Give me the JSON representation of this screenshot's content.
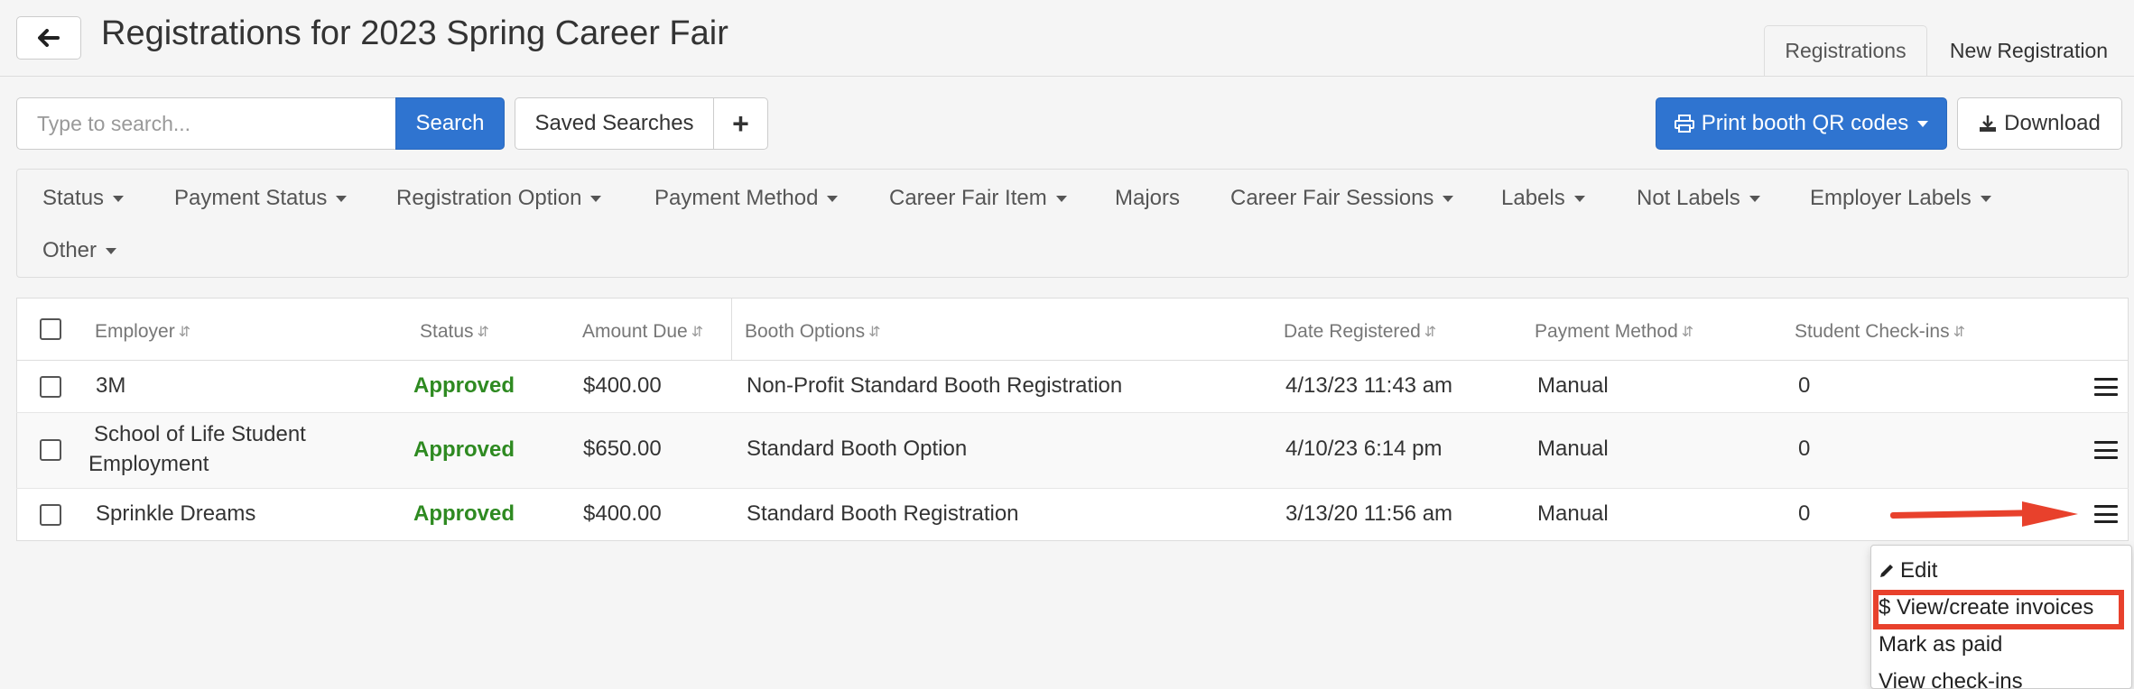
{
  "header": {
    "back_icon": "arrow-left-icon",
    "title": "Registrations for 2023 Spring Career Fair",
    "tabs": [
      {
        "label": "Registrations",
        "active": true
      },
      {
        "label": "New Registration",
        "active": false
      }
    ]
  },
  "toolbar": {
    "search_placeholder": "Type to search...",
    "search_label": "Search",
    "saved_searches_label": "Saved Searches",
    "add_icon": "plus-icon",
    "print_label": "Print booth QR codes",
    "print_icon": "printer-icon",
    "download_label": "Download",
    "download_icon": "download-icon"
  },
  "filters": [
    {
      "label": "Status",
      "dropdown": true
    },
    {
      "label": "Payment Status",
      "dropdown": true
    },
    {
      "label": "Registration Option",
      "dropdown": true
    },
    {
      "label": "Payment Method",
      "dropdown": true
    },
    {
      "label": "Career Fair Item",
      "dropdown": true
    },
    {
      "label": "Majors",
      "dropdown": false
    },
    {
      "label": "Career Fair Sessions",
      "dropdown": true
    },
    {
      "label": "Labels",
      "dropdown": true
    },
    {
      "label": "Not Labels",
      "dropdown": true
    },
    {
      "label": "Employer Labels",
      "dropdown": true
    },
    {
      "label": "Other",
      "dropdown": true
    }
  ],
  "table": {
    "columns": [
      "Employer",
      "Status",
      "Amount Due",
      "Booth Options",
      "Date Registered",
      "Payment Method",
      "Student Check-ins"
    ],
    "rows": [
      {
        "employer": "3M",
        "employer_line2": "",
        "status": "Approved",
        "amount_due": "$400.00",
        "booth_option": "Non-Profit Standard Booth Registration",
        "date_registered": "4/13/23 11:43 am",
        "payment_method": "Manual",
        "check_ins": "0"
      },
      {
        "employer": "School of Life Student",
        "employer_line2": "Employment",
        "status": "Approved",
        "amount_due": "$650.00",
        "booth_option": "Standard Booth Option",
        "date_registered": "4/10/23 6:14 pm",
        "payment_method": "Manual",
        "check_ins": "0"
      },
      {
        "employer": "Sprinkle Dreams",
        "employer_line2": "",
        "status": "Approved",
        "amount_due": "$400.00",
        "booth_option": "Standard Booth Registration",
        "date_registered": "3/13/20 11:56 am",
        "payment_method": "Manual",
        "check_ins": "0"
      }
    ]
  },
  "row_menu": {
    "items": [
      {
        "label": "Edit",
        "icon": "pencil-icon"
      },
      {
        "label": "$ View/create invoices",
        "icon": ""
      },
      {
        "label": "Mark as paid",
        "icon": ""
      },
      {
        "label": "View check-ins",
        "icon": ""
      }
    ],
    "highlighted_index": 1
  },
  "colors": {
    "primary": "#2f74d0",
    "approved": "#2e8a21",
    "annotation": "#e8412c"
  }
}
